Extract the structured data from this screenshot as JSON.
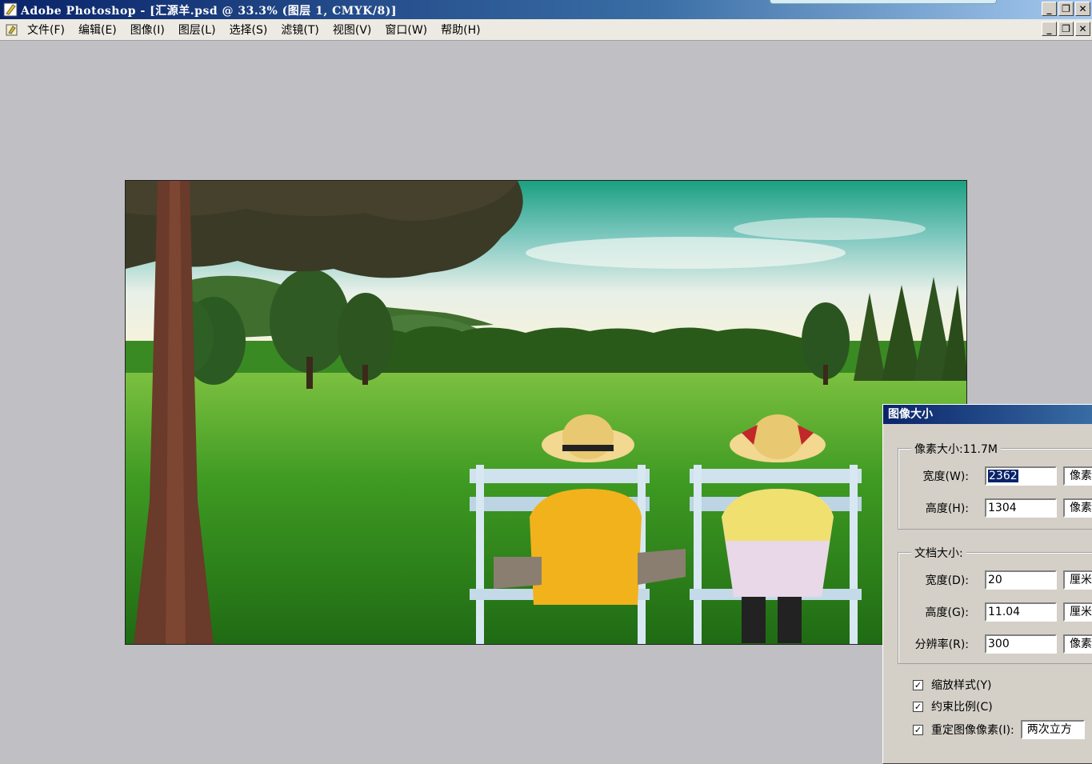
{
  "window": {
    "title": "Adobe Photoshop - [汇源羊.psd @ 33.3% (图层 1, CMYK/8)]"
  },
  "menu": {
    "items": [
      "文件(F)",
      "编辑(E)",
      "图像(I)",
      "图层(L)",
      "选择(S)",
      "滤镜(T)",
      "视图(V)",
      "窗口(W)",
      "帮助(H)"
    ]
  },
  "winbtns": {
    "minimize": "_",
    "restore": "❐",
    "close": "✕"
  },
  "dialog": {
    "title": "图像大小",
    "pixel_group": {
      "legend": "像素大小:11.7M",
      "width_label": "宽度(W):",
      "width_value": "2362",
      "width_unit": "像素",
      "height_label": "高度(H):",
      "height_value": "1304",
      "height_unit": "像素"
    },
    "doc_group": {
      "legend": "文档大小:",
      "width_label": "宽度(D):",
      "width_value": "20",
      "width_unit": "厘米",
      "height_label": "高度(G):",
      "height_value": "11.04",
      "height_unit": "厘米",
      "res_label": "分辨率(R):",
      "res_value": "300",
      "res_unit": "像素"
    },
    "options": {
      "scale_styles": "缩放样式(Y)",
      "constrain": "约束比例(C)",
      "resample": "重定图像像素(I):",
      "resample_method": "两次立方"
    }
  },
  "colors": {
    "titlebar": "#0a246a",
    "workspace": "#c0c0c4",
    "dialog_bg": "#d4d0c8"
  }
}
